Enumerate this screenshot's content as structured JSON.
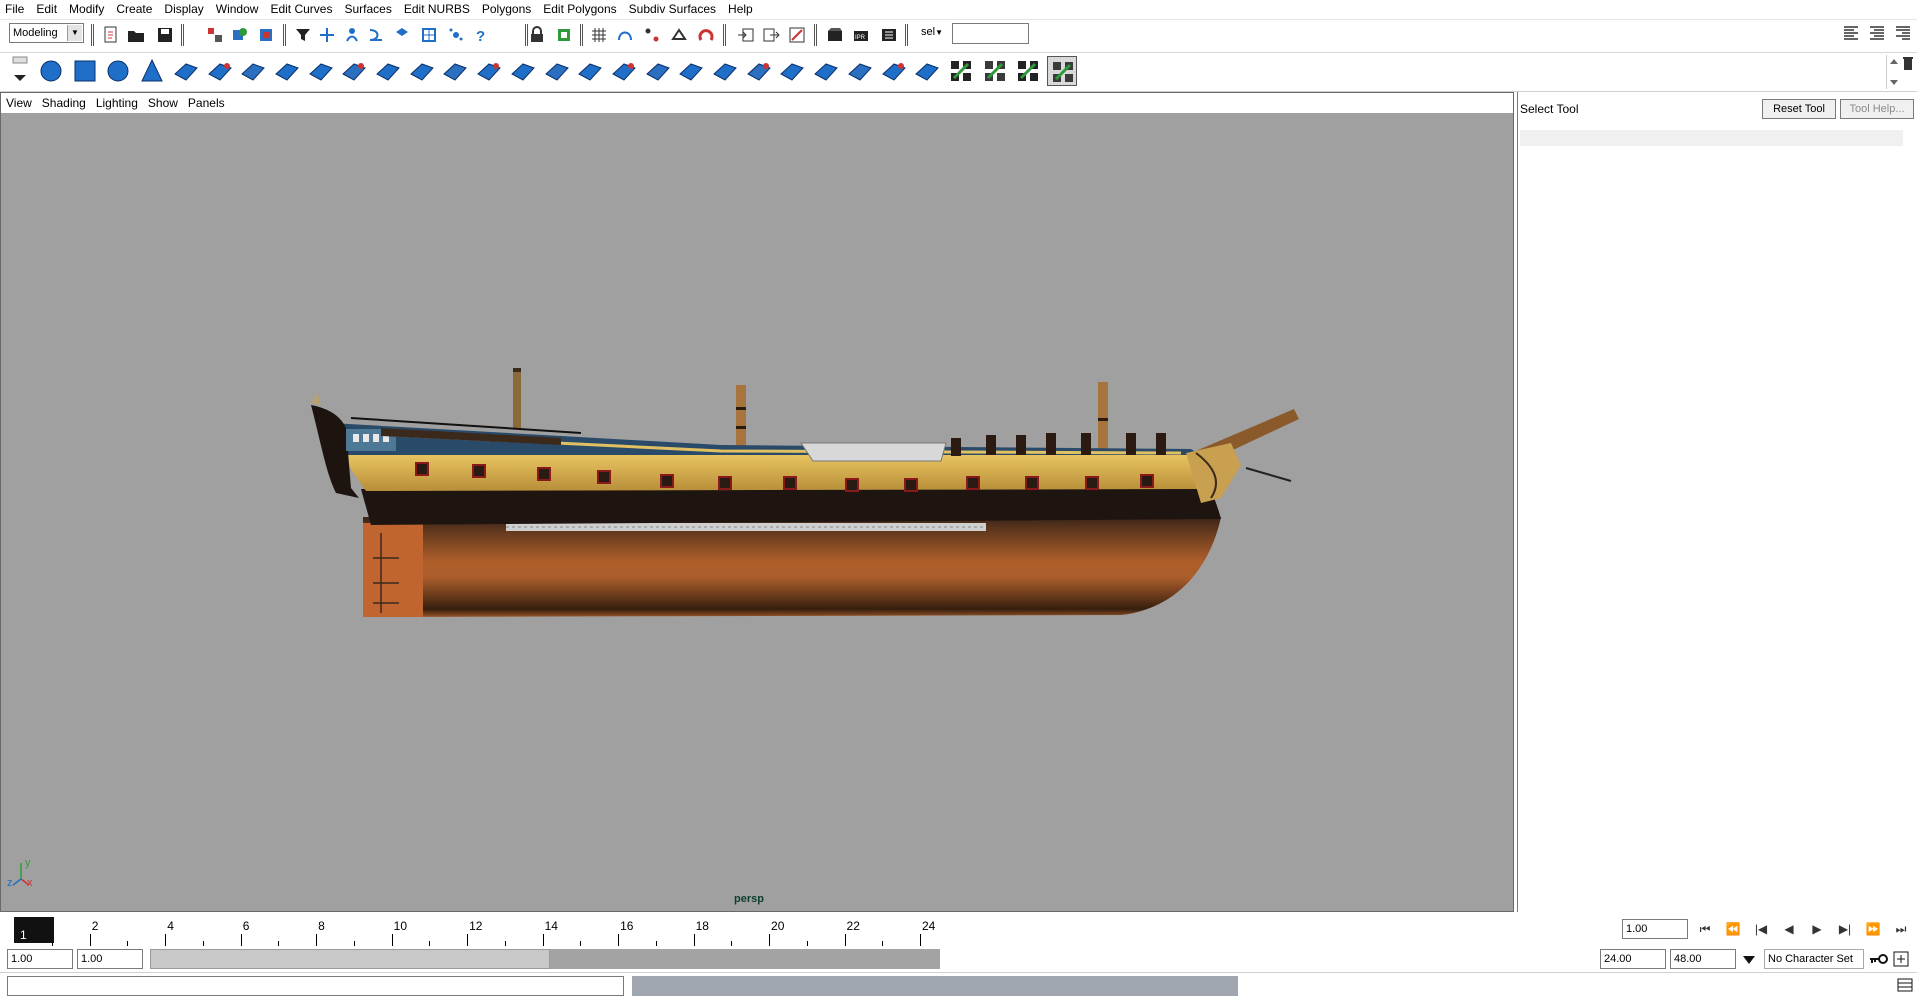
{
  "menubar": {
    "items": [
      "File",
      "Edit",
      "Modify",
      "Create",
      "Display",
      "Window",
      "Edit Curves",
      "Surfaces",
      "Edit NURBS",
      "Polygons",
      "Edit Polygons",
      "Subdiv Surfaces",
      "Help"
    ]
  },
  "statusline": {
    "mode": "Modeling",
    "sel_label": "sel",
    "sel_value": ""
  },
  "viewport": {
    "panel_menu": [
      "View",
      "Shading",
      "Lighting",
      "Show",
      "Panels"
    ],
    "camera_label": "persp",
    "axis_y": "y",
    "axis_z": "z",
    "axis_x": "x"
  },
  "tool_settings": {
    "title": "Select Tool",
    "reset_button": "Reset Tool",
    "help_button": "Tool Help..."
  },
  "time_slider": {
    "current_frame": "1",
    "ticks": [
      "2",
      "4",
      "6",
      "8",
      "10",
      "12",
      "14",
      "16",
      "18",
      "20",
      "22",
      "24"
    ],
    "current_time_field": "1.00"
  },
  "range_slider": {
    "start_time": "1.00",
    "range_start": "1.00",
    "range_end": "24.00",
    "end_time": "48.00",
    "character_set": "No Character Set"
  },
  "command_line": {
    "input": "",
    "result": ""
  },
  "colors": {
    "viewport_bg": "#a0a0a0",
    "shelf_icon_blue": "#1f6fc8",
    "current_frame_bg": "#111111",
    "persp_label": "#0e3f2e"
  }
}
